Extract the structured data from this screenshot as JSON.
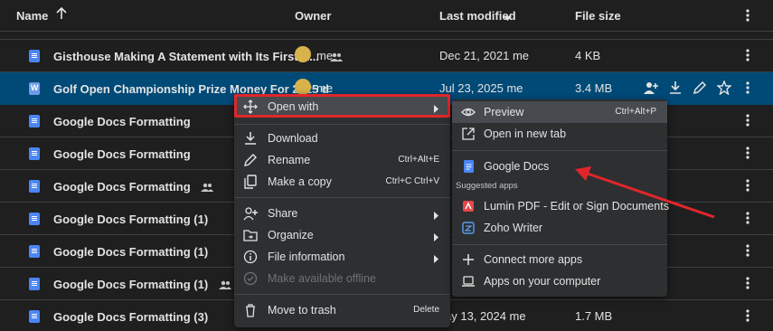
{
  "header": {
    "name": "Name",
    "owner": "Owner",
    "last_modified": "Last modified",
    "file_size": "File size"
  },
  "rows": [
    {
      "name": "Gisthouse Making A Statement with Its First A...",
      "shared": true,
      "owner": "me",
      "modified": "Dec 21, 2021 me",
      "size": "4 KB",
      "type": "doc"
    },
    {
      "name": "Golf Open Championship Prize Money For 2025 d",
      "shared": false,
      "owner": "me",
      "modified": "Jul 23, 2025 me",
      "size": "3.4 MB",
      "type": "word",
      "selected": true
    },
    {
      "name": "Google Docs Formatting",
      "shared": false,
      "type": "doc"
    },
    {
      "name": "Google Docs Formatting",
      "shared": false,
      "type": "doc"
    },
    {
      "name": "Google Docs Formatting",
      "shared": true,
      "type": "doc"
    },
    {
      "name": "Google Docs Formatting (1)",
      "shared": false,
      "type": "doc"
    },
    {
      "name": "Google Docs Formatting (1)",
      "shared": false,
      "type": "doc"
    },
    {
      "name": "Google Docs Formatting (1)",
      "shared": true,
      "type": "doc"
    },
    {
      "name": "Google Docs Formatting (3)",
      "shared": false,
      "modified": "ay 13, 2024 me",
      "size": "1.7 MB",
      "type": "doc"
    }
  ],
  "file_icon_letter": "W",
  "context_menu": {
    "open_with": "Open with",
    "download": "Download",
    "rename": "Rename",
    "rename_shortcut": "Ctrl+Alt+E",
    "make_copy": "Make a copy",
    "make_copy_shortcut": "Ctrl+C Ctrl+V",
    "share": "Share",
    "organize": "Organize",
    "file_information": "File information",
    "make_offline": "Make available offline",
    "move_to_trash": "Move to trash",
    "delete_shortcut": "Delete"
  },
  "submenu": {
    "preview": "Preview",
    "preview_shortcut": "Ctrl+Alt+P",
    "open_new_tab": "Open in new tab",
    "google_docs": "Google Docs",
    "suggested_apps": "Suggested apps",
    "lumin": "Lumin PDF - Edit or Sign Documents",
    "zoho": "Zoho Writer",
    "connect_more": "Connect more apps",
    "apps_on_computer": "Apps on your computer"
  },
  "colors": {
    "background": "#1f1f1f",
    "selected_row": "#004a77",
    "menu": "#2d2f31",
    "annotation_red": "#e0262b",
    "docs_blue": "#4a86f5"
  }
}
